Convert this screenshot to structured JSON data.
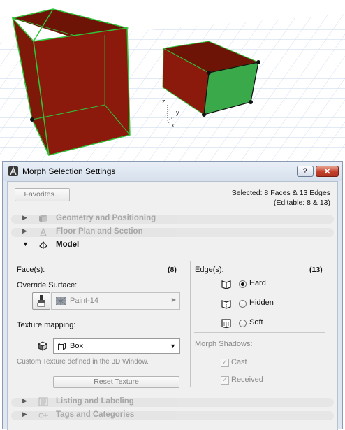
{
  "colors": {
    "face_red": "#8b1a0c",
    "face_green": "#3aa94a",
    "edge_green": "#2fc43a",
    "grid": "#c8d8ec",
    "dialog_frame": "#dfe7f1",
    "dialog_body": "#f0f0f0"
  },
  "viewport": {
    "axes": {
      "z": "z",
      "y": "y",
      "x": "x"
    }
  },
  "dialog": {
    "title": "Morph Selection Settings",
    "help_label": "?",
    "close_label": "✕",
    "favorites_label": "Favorites...",
    "selection_line1": "Selected: 8 Faces & 13 Edges",
    "selection_line2": "(Editable: 8 & 13)",
    "sections": {
      "geometry": "Geometry and Positioning",
      "floorplan": "Floor Plan and Section",
      "model": "Model",
      "listing": "Listing and Labeling",
      "tags": "Tags and Categories"
    },
    "model": {
      "faces_label": "Face(s):",
      "faces_count": "(8)",
      "override_surface_label": "Override Surface:",
      "surface_value": "Paint-14",
      "texture_mapping_label": "Texture mapping:",
      "texture_value": "Box",
      "custom_texture_note": "Custom Texture defined in the 3D Window.",
      "reset_texture_label": "Reset Texture",
      "edges_label": "Edge(s):",
      "edges_count": "(13)",
      "edge_options": [
        "Hard",
        "Hidden",
        "Soft"
      ],
      "edge_selected": "Hard",
      "morph_shadows_label": "Morph Shadows:",
      "cast_label": "Cast",
      "received_label": "Received",
      "cast_checked": true,
      "received_checked": true
    }
  }
}
